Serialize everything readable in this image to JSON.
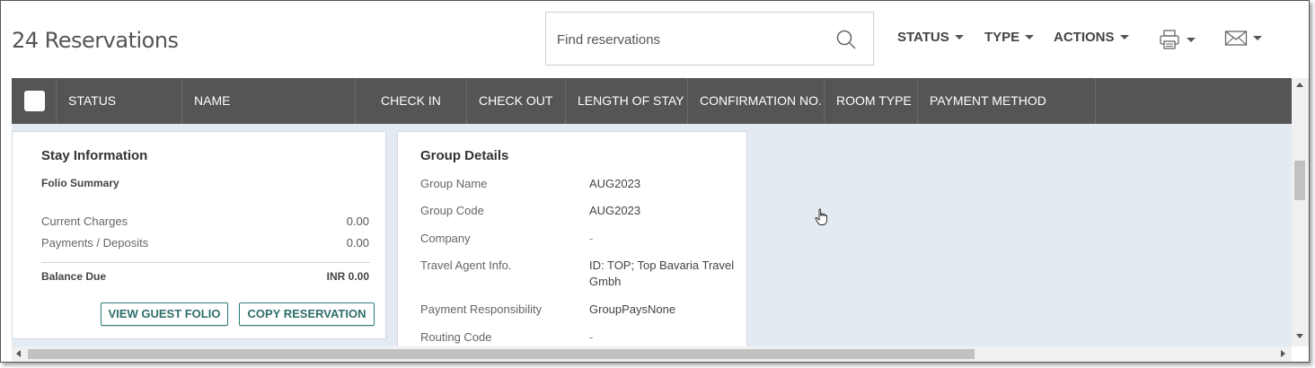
{
  "header": {
    "title": "24 Reservations",
    "search": {
      "placeholder": "Find reservations",
      "value": ""
    },
    "menus": [
      {
        "label": "STATUS"
      },
      {
        "label": "TYPE"
      },
      {
        "label": "ACTIONS"
      }
    ],
    "print_icon": "printer-icon",
    "email_icon": "envelope-icon"
  },
  "table": {
    "columns": [
      "STATUS",
      "NAME",
      "CHECK IN",
      "CHECK OUT",
      "LENGTH OF STAY",
      "CONFIRMATION NO.",
      "ROOM TYPE",
      "PAYMENT METHOD"
    ]
  },
  "stay_info": {
    "title": "Stay Information",
    "subtitle": "Folio Summary",
    "rows": [
      {
        "label": "Current Charges",
        "value": "0.00"
      },
      {
        "label": "Payments / Deposits",
        "value": "0.00"
      }
    ],
    "balance_label": "Balance Due",
    "balance_value": "INR 0.00",
    "view_folio_label": "VIEW GUEST FOLIO",
    "copy_reservation_label": "COPY RESERVATION"
  },
  "group_details": {
    "title": "Group Details",
    "rows": [
      {
        "label": "Group Name",
        "value": "AUG2023"
      },
      {
        "label": "Group Code",
        "value": "AUG2023"
      },
      {
        "label": "Company",
        "value": "-"
      },
      {
        "label": "Travel Agent Info.",
        "value": "ID: TOP; Top Bavaria Travel",
        "value2": "Gmbh"
      },
      {
        "label": "Payment Responsibility",
        "value": "GroupPaysNone"
      },
      {
        "label": "Routing Code",
        "value": "-"
      }
    ]
  },
  "colors": {
    "header_bar": "#555555",
    "body_bg": "#e3eaf2",
    "button_accent": "#2f7f7a"
  }
}
